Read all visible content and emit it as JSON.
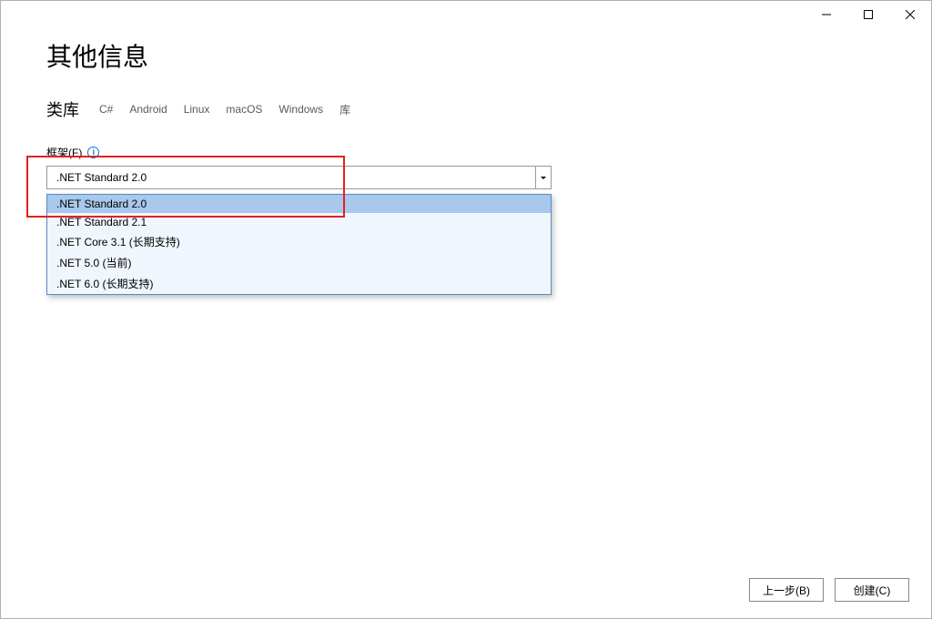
{
  "titlebar": {
    "minimize": "minimize",
    "maximize": "maximize",
    "close": "close"
  },
  "page": {
    "title": "其他信息"
  },
  "tags": {
    "label": "类库",
    "items": [
      "C#",
      "Android",
      "Linux",
      "macOS",
      "Windows",
      "库"
    ]
  },
  "framework": {
    "label": "框架(F)",
    "info_icon": "i",
    "selected": ".NET Standard 2.0",
    "options": [
      ".NET Standard 2.0",
      ".NET Standard 2.1",
      ".NET Core 3.1 (长期支持)",
      ".NET 5.0 (当前)",
      ".NET 6.0 (长期支持)"
    ]
  },
  "footer": {
    "back": "上一步(B)",
    "create": "创建(C)"
  }
}
